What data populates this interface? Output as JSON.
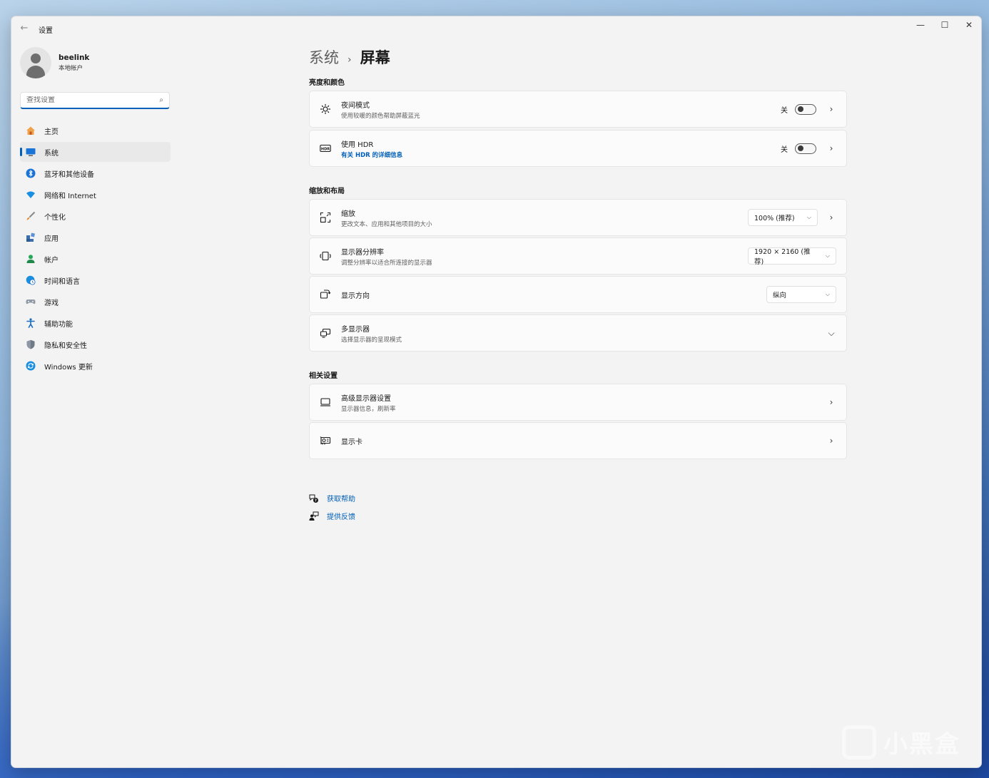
{
  "window": {
    "title": "设置"
  },
  "profile": {
    "name": "beelink",
    "account_type": "本地帐户"
  },
  "search": {
    "placeholder": "查找设置"
  },
  "nav": [
    {
      "label": "主页",
      "icon": "home-icon"
    },
    {
      "label": "系统",
      "icon": "system-icon",
      "active": true
    },
    {
      "label": "蓝牙和其他设备",
      "icon": "bluetooth-icon"
    },
    {
      "label": "网络和 Internet",
      "icon": "wifi-icon"
    },
    {
      "label": "个性化",
      "icon": "brush-icon"
    },
    {
      "label": "应用",
      "icon": "apps-icon"
    },
    {
      "label": "帐户",
      "icon": "account-icon"
    },
    {
      "label": "时间和语言",
      "icon": "globe-clock-icon"
    },
    {
      "label": "游戏",
      "icon": "gamepad-icon"
    },
    {
      "label": "辅助功能",
      "icon": "accessibility-icon"
    },
    {
      "label": "隐私和安全性",
      "icon": "shield-icon"
    },
    {
      "label": "Windows 更新",
      "icon": "update-icon"
    }
  ],
  "breadcrumb": {
    "parent": "系统",
    "current": "屏幕"
  },
  "sections": {
    "brightness": "亮度和颜色",
    "scale_layout": "缩放和布局",
    "related": "相关设置"
  },
  "night_light": {
    "title": "夜间模式",
    "subtitle": "使用较暖的颜色帮助屏蔽蓝光",
    "state": "关",
    "on": false
  },
  "hdr": {
    "title": "使用 HDR",
    "link": "有关 HDR 的详细信息",
    "state": "关",
    "on": false
  },
  "scale": {
    "title": "缩放",
    "subtitle": "更改文本、应用和其他项目的大小",
    "value": "100% (推荐)"
  },
  "resolution": {
    "title": "显示器分辨率",
    "subtitle": "调整分辨率以适合所连接的显示器",
    "value": "1920 × 2160 (推荐)"
  },
  "orientation": {
    "title": "显示方向",
    "value": "纵向"
  },
  "multi_display": {
    "title": "多显示器",
    "subtitle": "选择显示器的呈现模式"
  },
  "advanced_display": {
    "title": "高级显示器设置",
    "subtitle": "显示器信息，刷新率"
  },
  "graphics": {
    "title": "显示卡"
  },
  "help": {
    "get_help": "获取帮助",
    "feedback": "提供反馈"
  },
  "watermark": {
    "text": "小黑盒"
  },
  "colors": {
    "accent": "#005fb8",
    "window_bg": "#f3f3f3",
    "card_bg": "#fbfbfb"
  }
}
